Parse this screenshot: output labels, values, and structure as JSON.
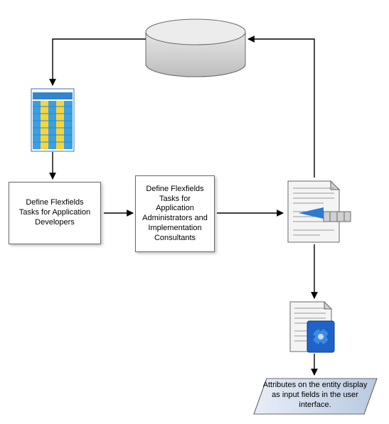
{
  "nodes": {
    "box1": "Define Flexfields Tasks\nfor Application Developers",
    "box2": "Define Flexfields Tasks for Application Administrators and Implementation Consultants",
    "attr": "Attributes\non the entity display as input fields in the user interface."
  }
}
